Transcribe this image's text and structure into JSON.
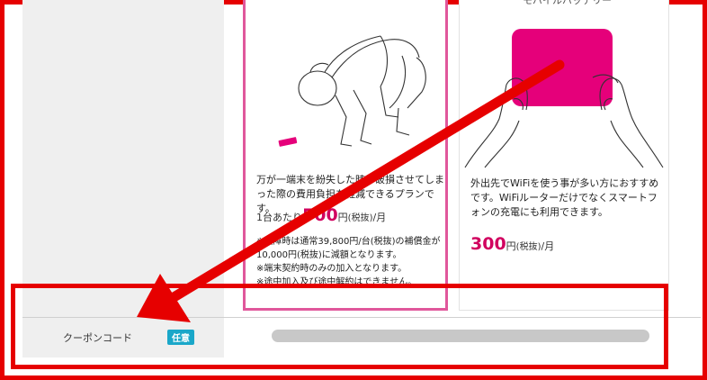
{
  "card_a": {
    "description": "万が一端末を紛失した時や破損させてしまった際の費用負担を軽減できるプランです。",
    "price_prefix": "1台あたり",
    "price_value": "500",
    "price_yen": "円",
    "price_tax": "(税抜)",
    "price_period": "/月",
    "note_1": "※故障時は通常39,800円/台(税抜)の補償金が10,000円(税抜)に減額となります。",
    "note_2": "※端末契約時のみの加入となります。",
    "note_3": "※途中加入及び途中解約はできません。"
  },
  "card_b": {
    "top_label": "モバイルバッテリー",
    "description": "外出先でWiFiを使う事が多い方におすすめです。WiFiルーターだけでなくスマートフォンの充電にも利用できます。",
    "price_value": "300",
    "price_yen": "円",
    "price_tax": "(税抜)",
    "price_period": "/月"
  },
  "coupon": {
    "label": "クーポンコード",
    "badge": "任意",
    "value": ""
  },
  "colors": {
    "annotation_red": "#e60000",
    "price_magenta": "#d1005f",
    "selected_card_border": "#e0579b",
    "badge_blue": "#1aa7c9",
    "battery_pink": "#e5007a"
  },
  "icons": {
    "card_a_image": "person-kneeling-lost-phone-illustration",
    "card_b_image": "hands-holding-battery-illustration"
  }
}
